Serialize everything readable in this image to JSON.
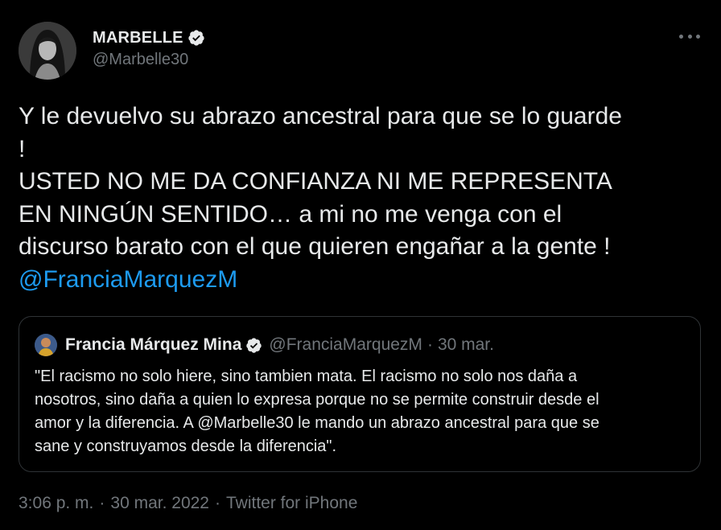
{
  "tweet": {
    "author": {
      "display_name": "MARBELLE",
      "handle": "@Marbelle30",
      "verified": true
    },
    "text_line1": "Y le devuelvo su abrazo ancestral para que se lo guarde",
    "text_line2": "!",
    "text_line3": "USTED NO ME DA CONFIANZA NI ME REPRESENTA",
    "text_line4": "EN NINGÚN SENTIDO… a mi no me venga con el",
    "text_line5": "discurso barato con el que quieren engañar a la gente !",
    "mention": "@FranciaMarquezM",
    "quote": {
      "display_name": "Francia Márquez Mina",
      "handle": "@FranciaMarquezM",
      "separator": "·",
      "date": "30 mar.",
      "verified": true,
      "text_line1": "\"El racismo no solo hiere, sino tambien mata. El racismo no solo nos daña a",
      "text_line2": "nosotros, sino daña a quien lo expresa porque no se permite construir desde el",
      "text_line3": "amor y la diferencia. A @Marbelle30 le mando un abrazo ancestral para que se",
      "text_line4": "sane y construyamos desde la diferencia\"."
    },
    "time": "3:06 p. m.",
    "date": "30 mar. 2022",
    "source": "Twitter for iPhone",
    "separator": "·"
  },
  "icons": {
    "more": "more-horizontal-icon",
    "verified": "verified-badge-icon"
  },
  "colors": {
    "background": "#000000",
    "text": "#e7e9ea",
    "secondary": "#71767b",
    "link": "#1d9bf0",
    "border": "#2f3336"
  }
}
